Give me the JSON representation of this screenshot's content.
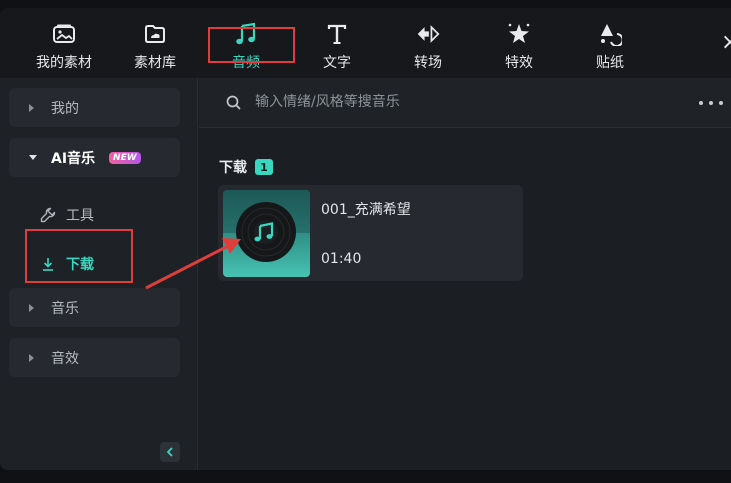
{
  "toolbar": {
    "items": [
      {
        "label": "我的素材",
        "icon": "my-media-icon"
      },
      {
        "label": "素材库",
        "icon": "stock-library-icon"
      },
      {
        "label": "音频",
        "icon": "music-note-icon",
        "active": true
      },
      {
        "label": "文字",
        "icon": "text-t-icon"
      },
      {
        "label": "转场",
        "icon": "transition-icon"
      },
      {
        "label": "特效",
        "icon": "effects-sparkle-icon"
      },
      {
        "label": "贴纸",
        "icon": "sticker-icon"
      }
    ]
  },
  "sidebar": {
    "items": [
      {
        "label": "我的"
      },
      {
        "label": "AI音乐",
        "badge": "NEW"
      },
      {
        "label": "工具"
      },
      {
        "label": "下载",
        "selected": true
      },
      {
        "label": "音乐"
      },
      {
        "label": "音效"
      }
    ]
  },
  "search": {
    "placeholder": "输入情绪/风格等搜音乐"
  },
  "section": {
    "title": "下载",
    "count": "1"
  },
  "card": {
    "title": "001_充满希望",
    "duration": "01:40"
  },
  "colors": {
    "accent": "#3ad6c0",
    "annotation": "#e03d3d",
    "badge_gradient_start": "#f2609f",
    "badge_gradient_end": "#b357e6"
  }
}
